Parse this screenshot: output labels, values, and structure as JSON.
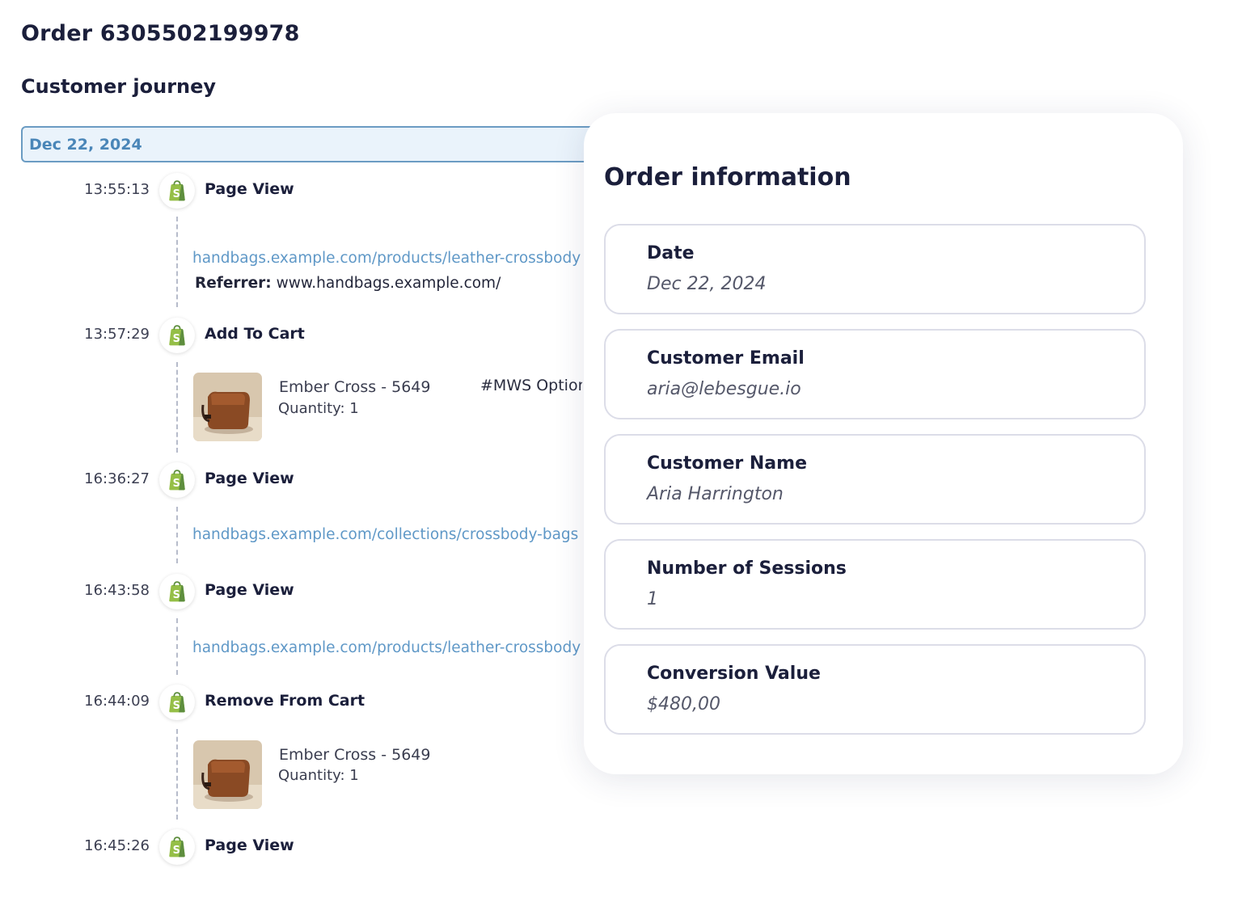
{
  "header": {
    "order_title": "Order 6305502199978",
    "journey_title": "Customer journey"
  },
  "journey": {
    "date": "Dec 22, 2024",
    "events": [
      {
        "time": "13:55:13",
        "type": "Page View",
        "icon": "shopify-bag-icon",
        "url": "handbags.example.com/products/leather-crossbody",
        "referrer_label": "Referrer:",
        "referrer": "www.handbags.example.com/"
      },
      {
        "time": "13:57:29",
        "type": "Add To Cart",
        "icon": "shopify-bag-icon",
        "product": {
          "name": "Ember Cross - 5649",
          "quantity": "Quantity: 1",
          "variant": "#MWS Option"
        }
      },
      {
        "time": "16:36:27",
        "type": "Page View",
        "icon": "shopify-bag-icon",
        "url": "handbags.example.com/collections/crossbody-bags"
      },
      {
        "time": "16:43:58",
        "type": "Page View",
        "icon": "shopify-bag-icon",
        "url": "handbags.example.com/products/leather-crossbody"
      },
      {
        "time": "16:44:09",
        "type": "Remove From Cart",
        "icon": "shopify-bag-icon",
        "product": {
          "name": "Ember Cross - 5649",
          "quantity": "Quantity: 1"
        }
      },
      {
        "time": "16:45:26",
        "type": "Page View",
        "icon": "shopify-bag-icon"
      }
    ]
  },
  "order_info": {
    "title": "Order information",
    "fields": [
      {
        "label": "Date",
        "value": "Dec 22, 2024"
      },
      {
        "label": "Customer Email",
        "value": "aria@lebesgue.io"
      },
      {
        "label": "Customer Name",
        "value": "Aria Harrington"
      },
      {
        "label": "Number of Sessions",
        "value": "1"
      },
      {
        "label": "Conversion Value",
        "value": "$480,00"
      }
    ]
  },
  "colors": {
    "heading": "#1b1f3b",
    "link": "#5f98c7",
    "date_bar_bg": "#eaf3fb",
    "date_bar_border": "#6b9cc3",
    "shopify_green": "#95bf47"
  }
}
